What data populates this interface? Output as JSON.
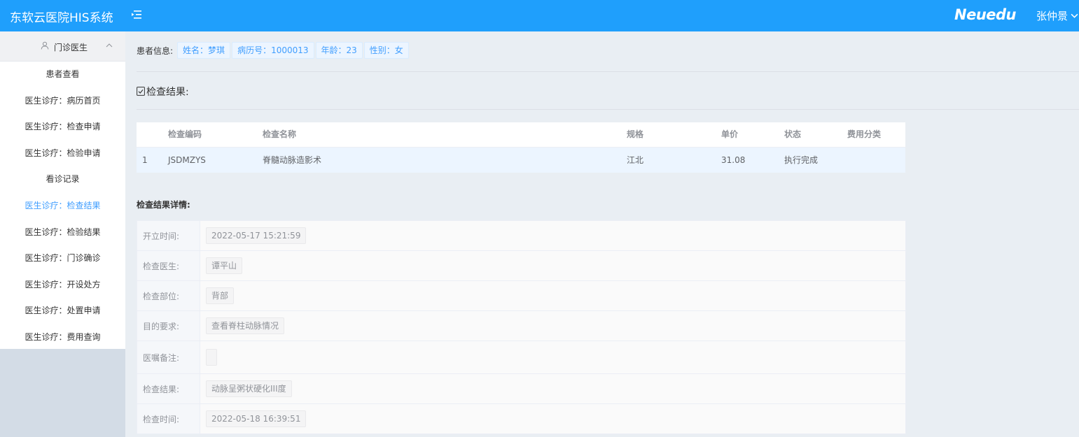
{
  "header": {
    "app_title": "东软云医院HIS系统",
    "brand": "Neuedu",
    "user_name": "张仲景",
    "menu_icon": "menu-fold-icon",
    "color_primary": "#1f9ffc"
  },
  "sidebar": {
    "group_label": "门诊医生",
    "group_icon": "user-icon",
    "items": [
      {
        "label": "患者查看"
      },
      {
        "label": "医生诊疗：病历首页"
      },
      {
        "label": "医生诊疗：检查申请"
      },
      {
        "label": "医生诊疗：检验申请"
      },
      {
        "label": "看诊记录"
      },
      {
        "label": "医生诊疗：检查结果"
      },
      {
        "label": "医生诊疗：检验结果"
      },
      {
        "label": "医生诊疗：门诊确诊"
      },
      {
        "label": "医生诊疗：开设处方"
      },
      {
        "label": "医生诊疗：处置申请"
      },
      {
        "label": "医生诊疗：费用查询"
      }
    ],
    "active_index": 5,
    "active_color": "#409eff"
  },
  "patient": {
    "label": "患者信息:",
    "name": "姓名：梦琪",
    "record_no": "病历号：1000013",
    "age": "年龄：23",
    "gender": "性别：女"
  },
  "section": {
    "title": "检查结果:"
  },
  "table": {
    "headers": [
      "",
      "检查编码",
      "检查名称",
      "规格",
      "单价",
      "状态",
      "费用分类"
    ],
    "rows": [
      [
        "1",
        "JSDMZYS",
        "脊髓动脉造影术",
        "江北",
        "31.08",
        "执行完成",
        ""
      ]
    ]
  },
  "detail": {
    "title": "检查结果详情:",
    "rows": [
      {
        "label": "开立时间:",
        "value": "2022-05-17 15:21:59"
      },
      {
        "label": "检查医生:",
        "value": "谭平山"
      },
      {
        "label": "检查部位:",
        "value": "背部"
      },
      {
        "label": "目的要求:",
        "value": "查看脊柱动脉情况"
      },
      {
        "label": "医嘱备注:",
        "value": ""
      },
      {
        "label": "检查结果:",
        "value": "动脉呈粥状硬化III度"
      },
      {
        "label": "检查时间:",
        "value": "2022-05-18 16:39:51"
      }
    ]
  }
}
